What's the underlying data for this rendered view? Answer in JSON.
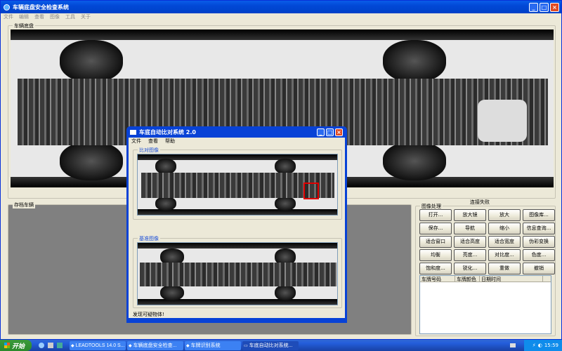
{
  "main_window": {
    "title": "车辆底盘安全检查系统",
    "menu": [
      "文件",
      "编辑",
      "查看",
      "图像",
      "工具",
      "关于"
    ]
  },
  "chassis_group": {
    "label": "车辆底盘"
  },
  "archive_group": {
    "label": "存档车辆"
  },
  "connection_status": "连接失败",
  "image_processing": {
    "label": "图像处理",
    "buttons": [
      "打开...",
      "放大镜",
      "放大",
      "图像库...",
      "保存...",
      "导航",
      "缩小",
      "信息查询...",
      "适合窗口",
      "适合高度",
      "适合宽度",
      "伪彩变换",
      "均衡",
      "亮度...",
      "对比度...",
      "色度...",
      "饱和度...",
      "锐化...",
      "重做",
      "撤销"
    ]
  },
  "table": {
    "columns": [
      "车牌号码",
      "车牌颜色",
      "日期时间"
    ]
  },
  "dialog": {
    "title": "车底自动比对系统 2.0",
    "menu": [
      "文件",
      "查看",
      "帮助"
    ],
    "compare_label": "比对图像",
    "reference_label": "基准图像",
    "status": "发现可疑物体!"
  },
  "taskbar": {
    "start": "开始",
    "tasks": [
      "LEADTOOLS 14.0 S...",
      "车辆底盘安全检查...",
      "车牌识别系统",
      "车底自动比对系统..."
    ],
    "clock": "15:59"
  },
  "colors": {
    "highlight": "#e00000"
  }
}
